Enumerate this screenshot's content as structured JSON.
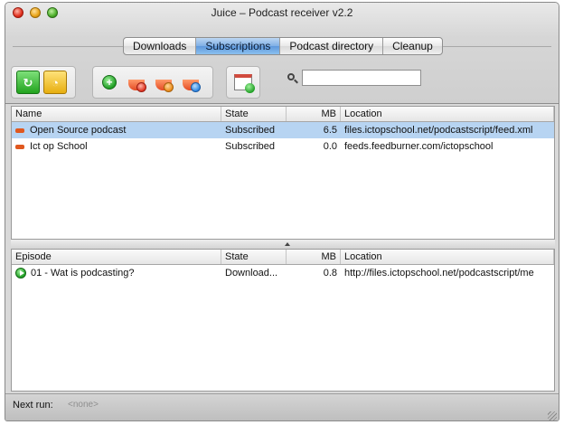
{
  "window": {
    "title": "Juice – Podcast receiver v2.2"
  },
  "tabs": [
    {
      "label": "Downloads",
      "active": false
    },
    {
      "label": "Subscriptions",
      "active": true
    },
    {
      "label": "Podcast directory",
      "active": false
    },
    {
      "label": "Cleanup",
      "active": false
    }
  ],
  "toolbar": {
    "buttons_left": [
      "refresh-icon",
      "schedule-icon"
    ],
    "buttons_middle": [
      "add-feed-icon",
      "remove-feed-icon",
      "feed-settings-icon",
      "feed-info-icon"
    ],
    "buttons_right": [
      "check-schedule-icon"
    ],
    "search": {
      "value": "",
      "placeholder": ""
    }
  },
  "subscriptions": {
    "headers": {
      "name": "Name",
      "state": "State",
      "mb": "MB",
      "location": "Location"
    },
    "rows": [
      {
        "name": "Open Source podcast",
        "state": "Subscribed",
        "mb": "6.5",
        "location": "files.ictopschool.net/podcastscript/feed.xml",
        "selected": true
      },
      {
        "name": "Ict op School",
        "state": "Subscribed",
        "mb": "0.0",
        "location": "feeds.feedburner.com/ictopschool",
        "selected": false
      }
    ]
  },
  "episodes": {
    "headers": {
      "name": "Episode",
      "state": "State",
      "mb": "MB",
      "location": "Location"
    },
    "rows": [
      {
        "name": "01 - Wat is podcasting?",
        "state": "Download...",
        "mb": "0.8",
        "location": "http://files.ictopschool.net/podcastscript/me",
        "selected": false
      }
    ]
  },
  "status": {
    "label": "Next run:",
    "value": "<none>"
  },
  "colors": {
    "selected_row": "#b7d4f2",
    "active_tab": "#7fb0e6",
    "feed_icon": "#e0581f"
  }
}
